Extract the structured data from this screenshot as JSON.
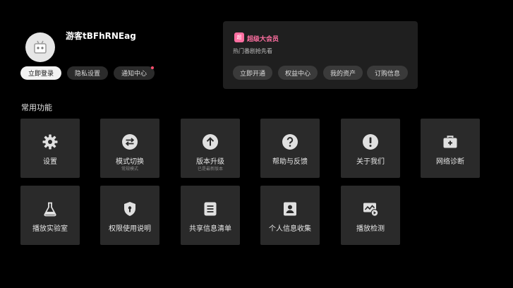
{
  "profile": {
    "username": "游客tBFhRNEag"
  },
  "actions": {
    "login": "立即登录",
    "privacy": "隐私设置",
    "notify": "通知中心"
  },
  "vip": {
    "badge": "超",
    "title": "超级大会员",
    "subtitle": "热门番剧抢先看",
    "buttons": [
      "立即开通",
      "权益中心",
      "我的资产",
      "订购信息"
    ]
  },
  "section": {
    "title": "常用功能"
  },
  "tiles": [
    {
      "label": "设置",
      "icon": "gear-icon"
    },
    {
      "label": "模式切换",
      "sub": "常规模式",
      "icon": "swap-icon"
    },
    {
      "label": "版本升级",
      "sub": "已是最新版本",
      "icon": "upgrade-icon"
    },
    {
      "label": "帮助与反馈",
      "icon": "help-icon"
    },
    {
      "label": "关于我们",
      "icon": "info-icon"
    },
    {
      "label": "网络诊断",
      "icon": "toolbox-icon"
    },
    {
      "label": "播放实验室",
      "icon": "flask-icon"
    },
    {
      "label": "权限使用说明",
      "icon": "shield-icon"
    },
    {
      "label": "共享信息清单",
      "icon": "list-icon"
    },
    {
      "label": "个人信息收集",
      "icon": "contact-icon"
    },
    {
      "label": "播放检测",
      "icon": "monitor-play-icon"
    }
  ],
  "colors": {
    "background": "#000000",
    "tile": "#2a2a2a",
    "accent": "#ff6fa1"
  }
}
